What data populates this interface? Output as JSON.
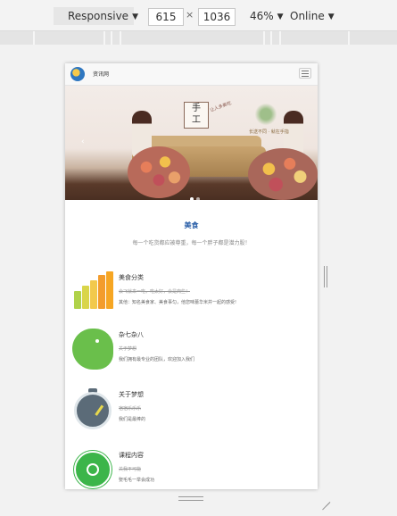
{
  "toolbar": {
    "device_mode": "Responsive",
    "width": "615",
    "height": "1036",
    "times": "×",
    "zoom": "46%",
    "network": "Online",
    "dropdown_arrow": "▼"
  },
  "site": {
    "brand": "资讯网",
    "banner": {
      "title_line1": "手",
      "title_line2": "工",
      "subtitle": "让人多美吃",
      "slogan": "长送不同 · 就在手指",
      "prev_arrow": "‹"
    },
    "section": {
      "title": "美食",
      "subtitle": "每一个吃货都应被尊重，每一个胖子都是潜力股！"
    },
    "features": [
      {
        "icon": "bar-chart-icon",
        "title": "美食分类",
        "strike": "会飞就来一吃，吃太好，会是肉些！",
        "desc": "其他：知名美食家、美食事匀，他您味蕾华米并一起的感受!"
      },
      {
        "icon": "elephant-icon",
        "title": "杂七杂八",
        "strike": "关于梦想",
        "desc": "我们拥有最专业的团队，欢迎加入我们"
      },
      {
        "icon": "clock-icon",
        "title": "关于梦想",
        "strike": "宿宿乐乐乐",
        "desc": "我们是最棒的"
      },
      {
        "icon": "whatsapp-icon",
        "title": "课程内容",
        "strike": "关我不可能",
        "desc": "娶毛毛一举会成功"
      }
    ]
  },
  "colors": {
    "accent": "#2a5fa8",
    "bar_icon": [
      "#b0d24a",
      "#f2c94c",
      "#f39c2c",
      "#f6a623",
      "#e9c645"
    ],
    "elephant": "#6abf4b",
    "clock": "#5b6b78",
    "whatsapp": "#3cb54a"
  }
}
